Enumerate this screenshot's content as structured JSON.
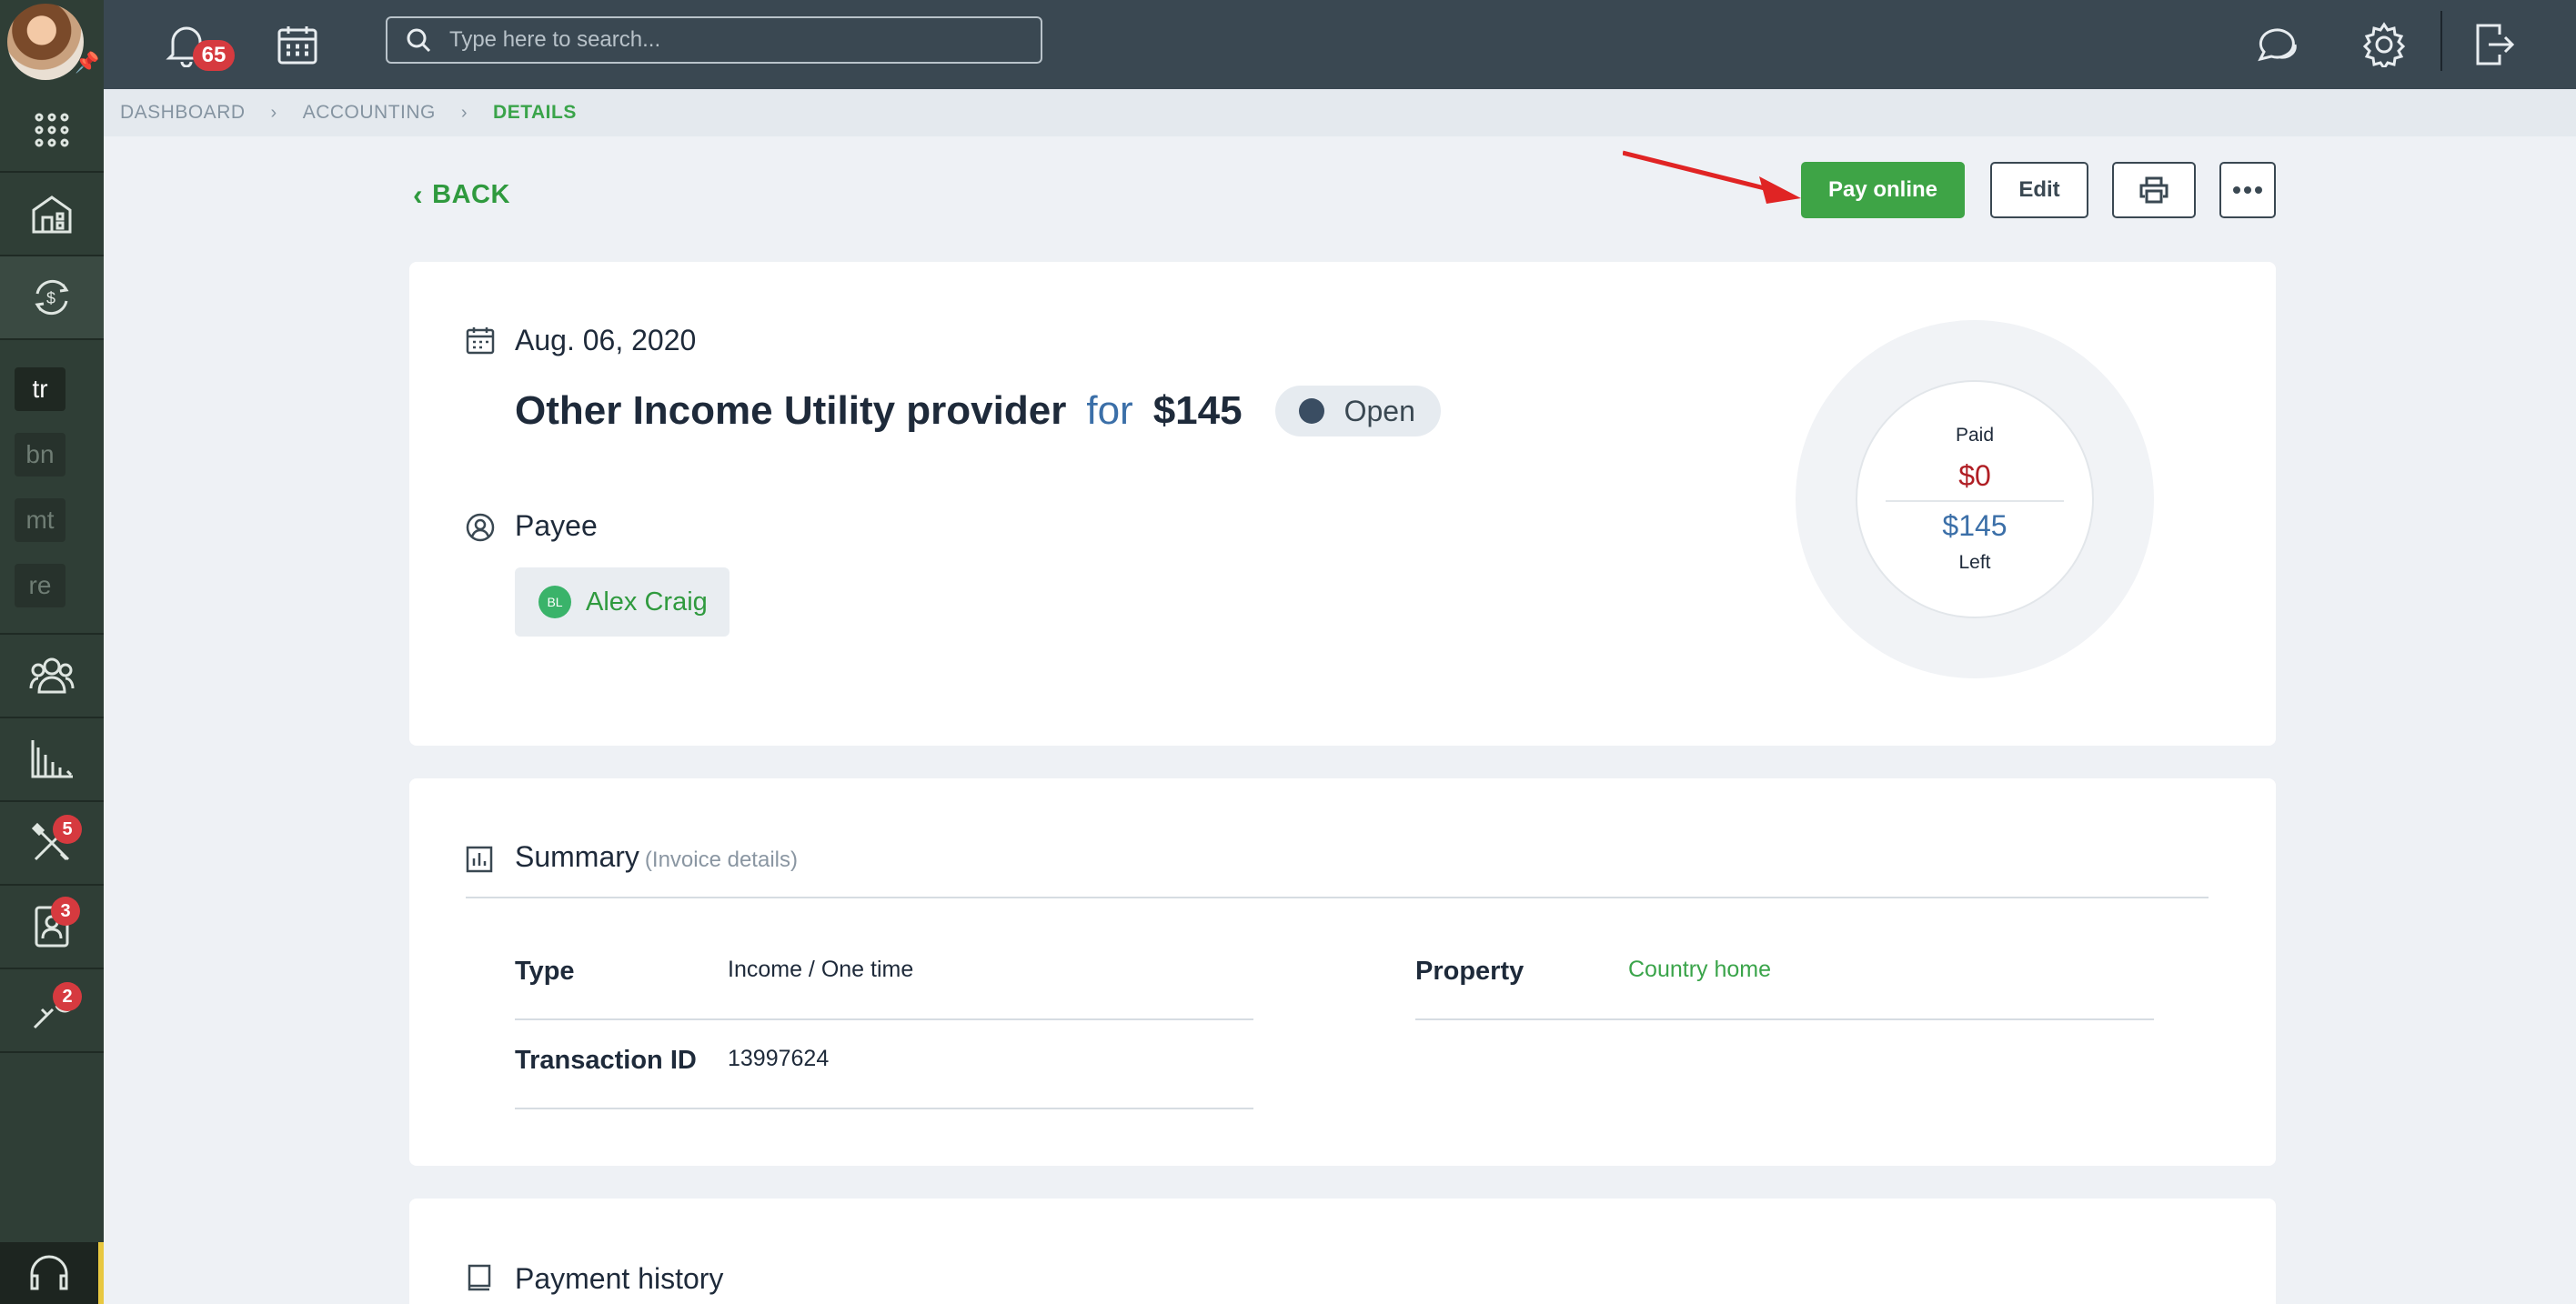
{
  "topbar": {
    "notifications_count": "65",
    "search_placeholder": "Type here to search..."
  },
  "sidebar": {
    "tags": [
      "tr",
      "bn",
      "mt",
      "re"
    ],
    "badges": {
      "tools": "5",
      "contacts": "3",
      "maintenance": "2"
    }
  },
  "breadcrumb": {
    "items": [
      "DASHBOARD",
      "ACCOUNTING"
    ],
    "current": "DETAILS",
    "separator": "›"
  },
  "actions": {
    "back": "BACK",
    "pay_online": "Pay online",
    "edit": "Edit"
  },
  "transaction": {
    "date": "Aug. 06, 2020",
    "title": "Other Income Utility provider",
    "for_word": "for",
    "amount": "$145",
    "status": "Open",
    "payee_label": "Payee",
    "payee_initials": "BL",
    "payee_name": "Alex Craig"
  },
  "progress": {
    "paid_label": "Paid",
    "paid_value": "$0",
    "total_value": "$145",
    "left_label": "Left",
    "paid_fraction": 0
  },
  "summary": {
    "title": "Summary",
    "subtitle": "(Invoice details)",
    "type_label": "Type",
    "type_value": "Income / One time",
    "transaction_id_label": "Transaction ID",
    "transaction_id_value": "13997624",
    "property_label": "Property",
    "property_value": "Country home"
  },
  "payment_history": {
    "title": "Payment history"
  },
  "colors": {
    "accent_green": "#3ea446",
    "sidebar_bg": "#2f3e36",
    "topbar_bg": "#3a4852",
    "badge_red": "#d63a3f",
    "annotation_arrow": "#e02424"
  }
}
